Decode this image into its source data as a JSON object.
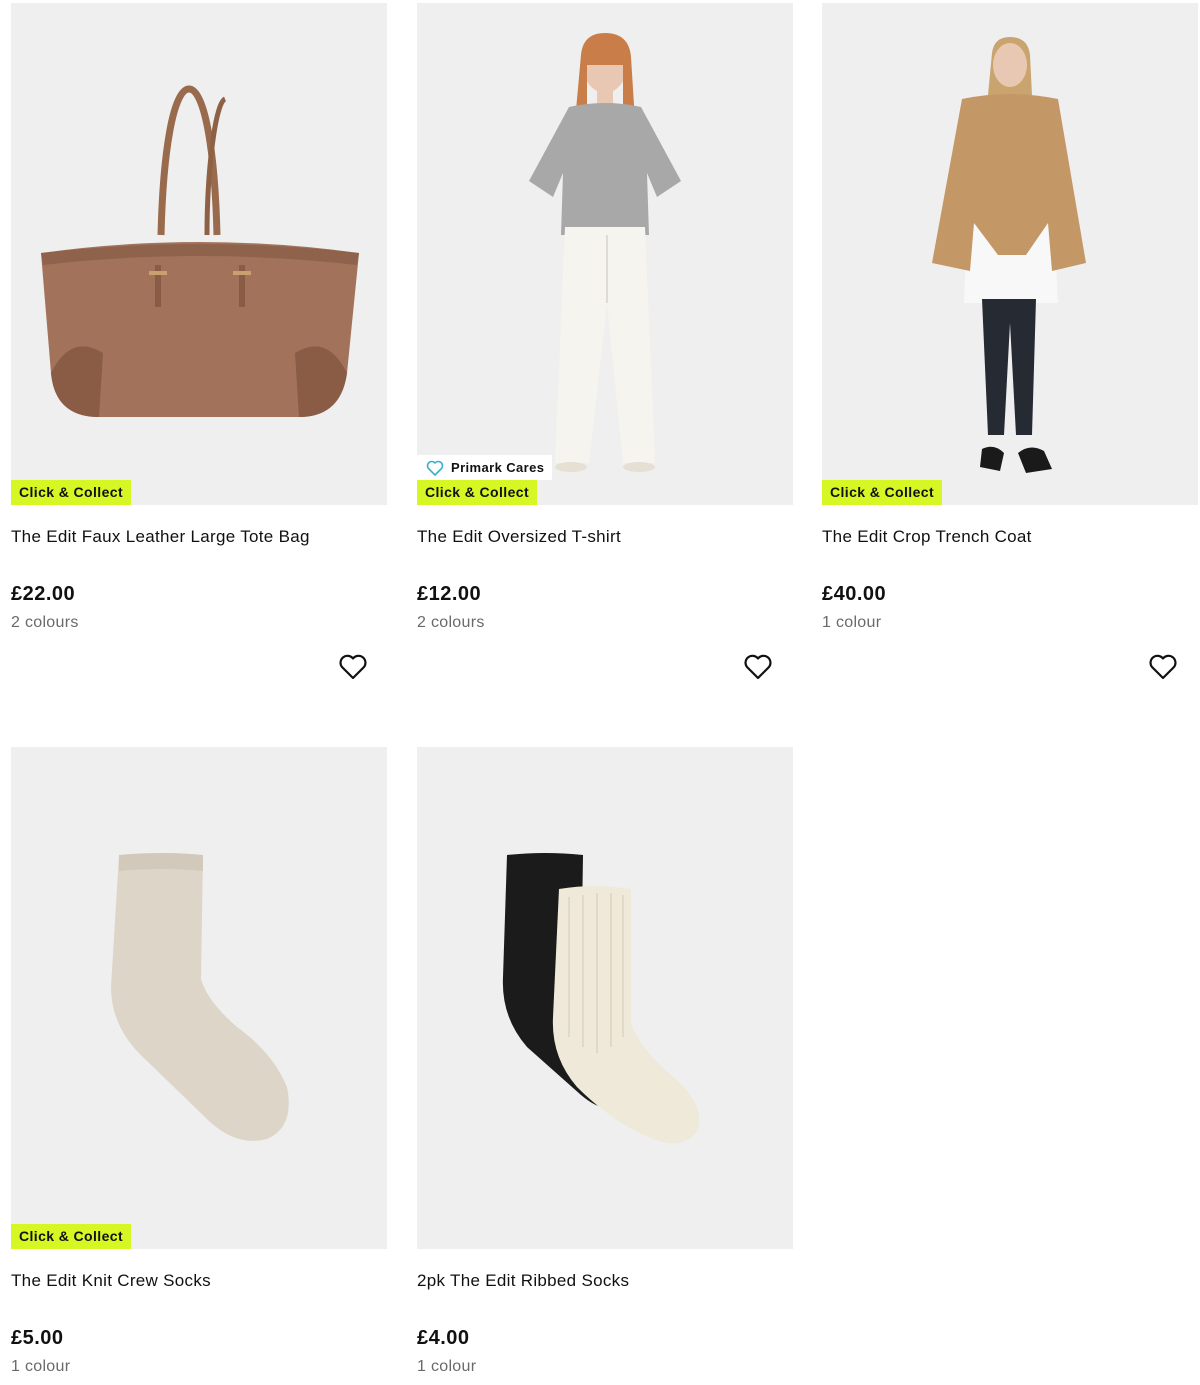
{
  "products": [
    {
      "title": "The Edit Faux Leather Large Tote Bag",
      "price": "£22.00",
      "colours": "2 colours",
      "badge": "Click & Collect"
    },
    {
      "title": "The Edit Oversized T-shirt",
      "price": "£12.00",
      "colours": "2 colours",
      "badge": "Click & Collect",
      "cares_badge": "Primark Cares"
    },
    {
      "title": "The Edit Crop Trench Coat",
      "price": "£40.00",
      "colours": "1 colour",
      "badge": "Click & Collect"
    },
    {
      "title": "The Edit Knit Crew Socks",
      "price": "£5.00",
      "colours": "1 colour",
      "badge": "Click & Collect"
    },
    {
      "title": "2pk The Edit Ribbed Socks",
      "price": "£4.00",
      "colours": "1 colour"
    }
  ],
  "icons": {
    "favourite": "heart-outline-icon",
    "cares": "heart-outline-icon"
  },
  "colors": {
    "badge_background": "#d6f724",
    "image_background": "#efefef",
    "cares_icon": "#3ab0c8"
  }
}
